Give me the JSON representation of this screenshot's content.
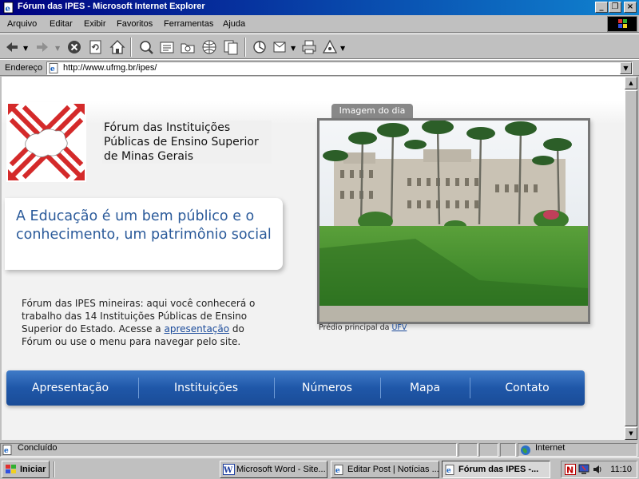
{
  "window": {
    "title": "Fórum das IPES - Microsoft Internet Explorer",
    "controls": {
      "minimize": "_",
      "maximize": "❐",
      "close": "×"
    }
  },
  "menu": {
    "items": [
      {
        "label": "Arquivo"
      },
      {
        "label": "Editar"
      },
      {
        "label": "Exibir"
      },
      {
        "label": "Favoritos"
      },
      {
        "label": "Ferramentas"
      },
      {
        "label": "Ajuda"
      }
    ]
  },
  "toolbar": {
    "buttons": [
      "back",
      "forward",
      "stop",
      "refresh",
      "home",
      "search",
      "favorites",
      "history",
      "channels",
      "fullscreen",
      "mail",
      "edit",
      "print",
      "discuss"
    ]
  },
  "address": {
    "label": "Endereço",
    "url": "http://www.ufmg.br/ipes/"
  },
  "page": {
    "site_title_lines": [
      "Fórum das Instituições",
      "Públicas de Ensino Superior",
      "de Minas Gerais"
    ],
    "slogan": "A Educação é um bem público e o conhecimento, um patrimônio social",
    "intro_before_link": "Fórum das IPES mineiras: aqui você conhecerá o trabalho das 14 Instituições Públicas de Ensino Superior do Estado. Acesse a ",
    "intro_link": "apresentação",
    "intro_after_link": " do Fórum ou use o menu para navegar pelo site.",
    "image_tab": "Imagem do dia",
    "image_caption_prefix": "Prédio principal da ",
    "image_caption_link": "UFV",
    "nav": [
      {
        "label": "Apresentação"
      },
      {
        "label": "Instituições"
      },
      {
        "label": "Números"
      },
      {
        "label": "Mapa"
      },
      {
        "label": "Contato"
      }
    ],
    "colors": {
      "slogan": "#2a5a9a",
      "nav": "#1f57a8",
      "logo_red": "#d42a2a"
    }
  },
  "status": {
    "text": "Concluído",
    "zone": "Internet"
  },
  "taskbar": {
    "start": "Iniciar",
    "tasks": [
      {
        "label": "Microsoft Word - Site..."
      },
      {
        "label": "Editar Post | Notícias ..."
      },
      {
        "label": "Fórum das IPES -..."
      }
    ],
    "clock": "11:10"
  }
}
